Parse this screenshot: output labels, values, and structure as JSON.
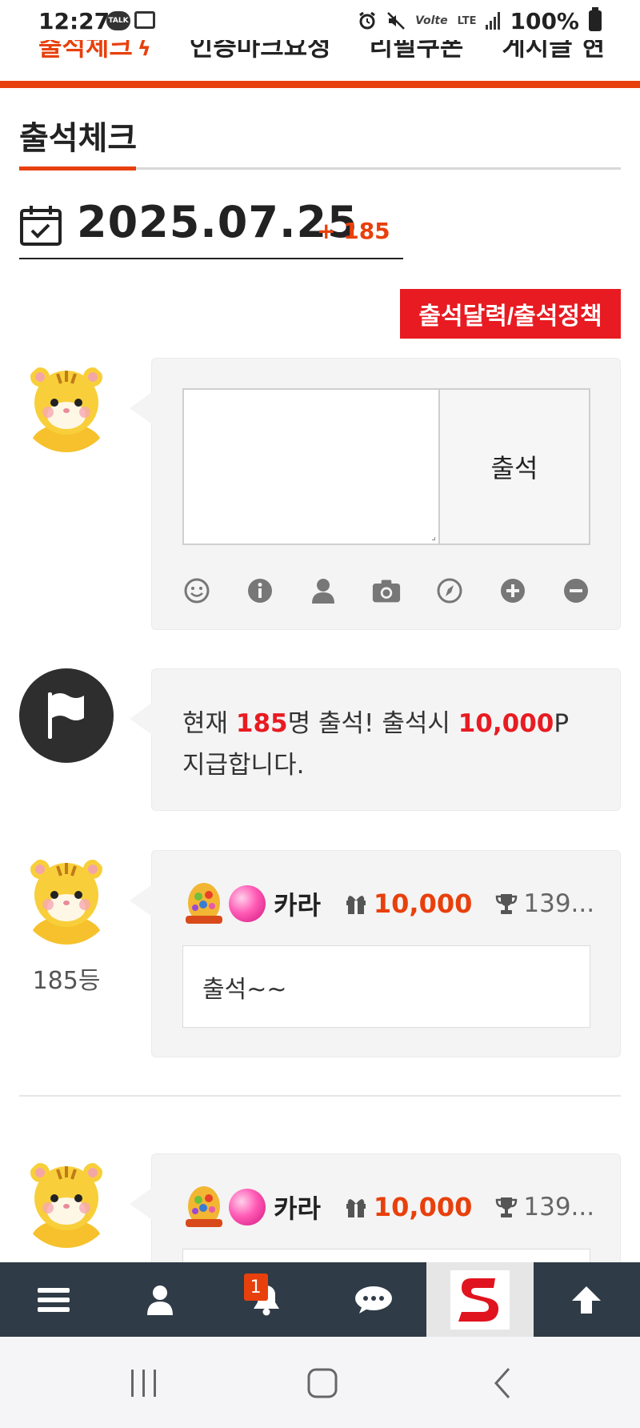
{
  "status_bar": {
    "time": "12:27",
    "talk_label": "TALK",
    "volte_label": "Volte",
    "lte_label": "LTE",
    "battery_percent": "100%"
  },
  "top_nav": {
    "tabs": [
      {
        "label": "출석체크",
        "active": true
      },
      {
        "label": "인증마크요청",
        "active": false
      },
      {
        "label": "리필쿠폰",
        "active": false
      },
      {
        "label": "게시글 현",
        "active": false
      }
    ],
    "accent_color": "#e8400c"
  },
  "page": {
    "title": "출석체크",
    "date": "2025.07.25",
    "date_count": "+ 185",
    "policy_button": "출석달력/출석정책"
  },
  "composer": {
    "textarea_value": "",
    "submit_label": "출석",
    "tools": [
      "smile-icon",
      "info-icon",
      "user-icon",
      "camera-icon",
      "compass-icon",
      "plus-circle-icon",
      "minus-circle-icon"
    ]
  },
  "info": {
    "prefix": "현재 ",
    "count": "185",
    "mid": "명 출석! 출석시 ",
    "points": "10,000",
    "suffix": "P 지급합니다."
  },
  "entries": [
    {
      "username": "카라",
      "points": "10,000",
      "score": "139...",
      "comment": "출석~~",
      "rank": "185등"
    },
    {
      "username": "카라",
      "points": "10,000",
      "score": "139...",
      "comment": "",
      "rank": ""
    }
  ],
  "bottom_bar": {
    "notification_count": "1",
    "items": [
      "menu-icon",
      "user-icon",
      "bell-icon",
      "chat-icon",
      "site-logo",
      "arrow-up-icon"
    ]
  },
  "colors": {
    "brand_red": "#e81b22",
    "accent_orange": "#e8400c",
    "bottom_bar_bg": "#2f3b46"
  }
}
